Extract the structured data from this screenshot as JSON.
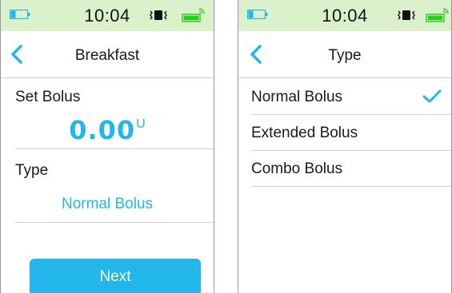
{
  "left_screen": {
    "status": {
      "time": "10:04"
    },
    "nav": {
      "title": "Breakfast"
    },
    "set_bolus_label": "Set Bolus",
    "bolus_value": "0.00",
    "bolus_unit": "U",
    "type_label": "Type",
    "type_value": "Normal Bolus",
    "next_label": "Next"
  },
  "right_screen": {
    "status": {
      "time": "10:04"
    },
    "nav": {
      "title": "Type"
    },
    "options": [
      {
        "label": "Normal Bolus",
        "selected": true
      },
      {
        "label": "Extended Bolus",
        "selected": false
      },
      {
        "label": "Combo Bolus",
        "selected": false
      }
    ]
  },
  "colors": {
    "accent": "#22b6ea",
    "status_bar_bg": "#daf1cc",
    "battery_fill": "#22b6ea",
    "phone_battery": "#2ecc1f",
    "divider": "#d2d2d2"
  },
  "icons": {
    "battery": "pump-battery-icon",
    "vibrate": "vibrate-icon",
    "phone_battery": "phone-battery-icon",
    "back": "back-chevron-icon",
    "check": "checkmark-icon"
  }
}
